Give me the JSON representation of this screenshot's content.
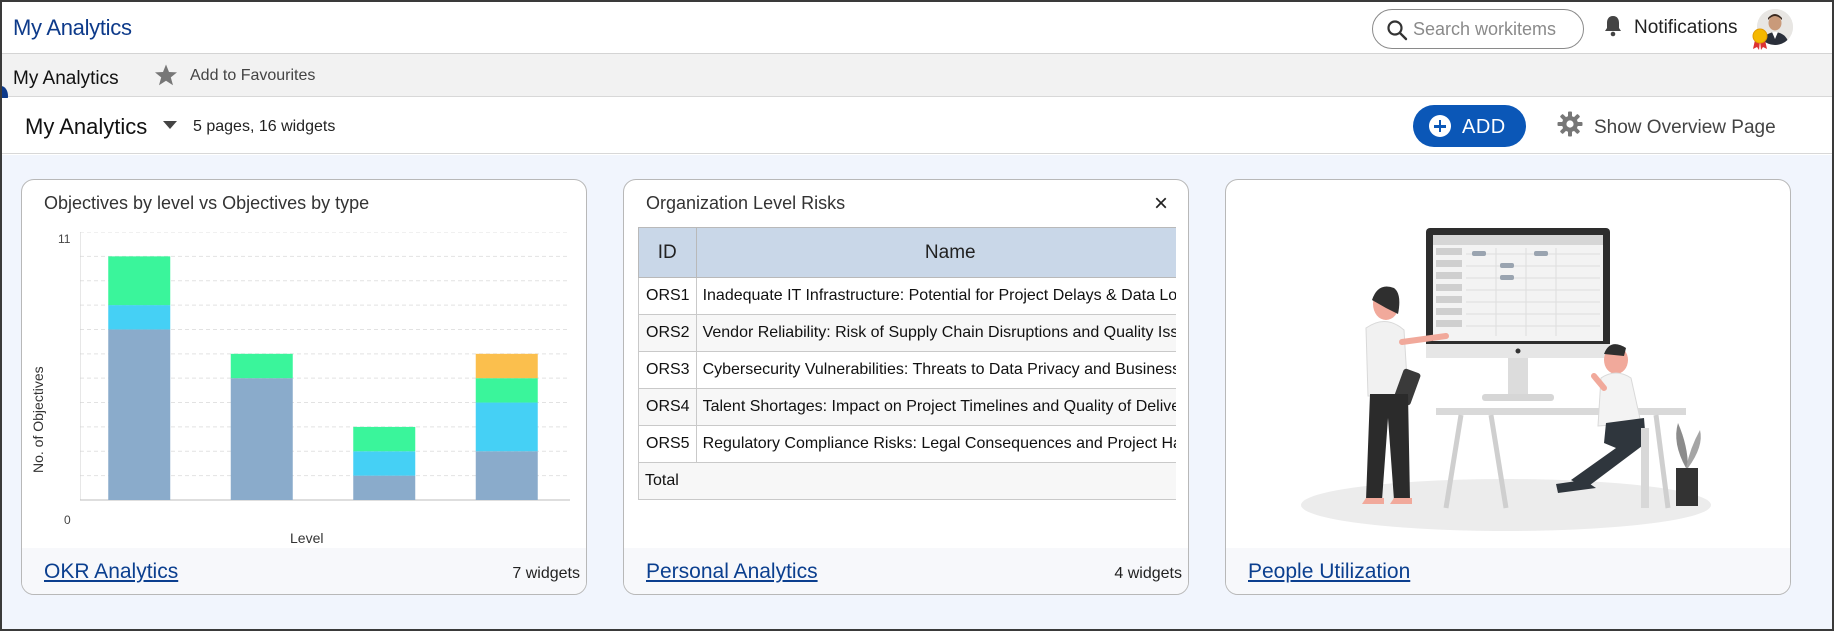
{
  "app": {
    "title": "My Analytics"
  },
  "search": {
    "placeholder": "Search workitems"
  },
  "notifications": {
    "label": "Notifications"
  },
  "breadcrumb": {
    "title": "My Analytics",
    "favourite_label": "Add to Favourites"
  },
  "dashboard": {
    "title": "My Analytics",
    "meta": "5 pages, 16 widgets",
    "add_label": "ADD",
    "overview_label": "Show Overview Page"
  },
  "colors": {
    "accent": "#0b57b7",
    "link": "#0b3f8f",
    "bar_blue": "#8aabcb",
    "bar_cyan": "#45d0f5",
    "bar_green": "#3af59b",
    "bar_orange": "#fbbf4d"
  },
  "cards": [
    {
      "link": "OKR Analytics",
      "count": "7 widgets",
      "widget_title": "Objectives by level vs Objectives by type",
      "chart": {
        "ylabel": "No. of Objectives",
        "xlabel": "Level",
        "ymin_label": "0",
        "ymax_label": "11"
      }
    },
    {
      "link": "Personal Analytics",
      "count": "4 widgets",
      "widget_title": "Organization Level Risks",
      "close_icon": "×",
      "table": {
        "headers": [
          "ID",
          "Name"
        ],
        "rows": [
          [
            "ORS1",
            "Inadequate IT Infrastructure: Potential for Project Delays & Data Los"
          ],
          [
            "ORS2",
            "Vendor Reliability: Risk of Supply Chain Disruptions and Quality Issu"
          ],
          [
            "ORS3",
            "Cybersecurity Vulnerabilities: Threats to Data Privacy and Business C"
          ],
          [
            "ORS4",
            "Talent Shortages: Impact on Project Timelines and Quality of Deliver"
          ],
          [
            "ORS5",
            "Regulatory Compliance Risks: Legal Consequences and Project Halts"
          ]
        ],
        "total_label": "Total"
      }
    },
    {
      "link": "People Utilization",
      "count": "",
      "illustration": "people-at-computer-illustration"
    }
  ],
  "chart_data": {
    "type": "bar",
    "title": "Objectives by level vs Objectives by type",
    "xlabel": "Level",
    "ylabel": "No. of Objectives",
    "ylim": [
      0,
      11
    ],
    "grid": true,
    "stacked": true,
    "categories": [
      "",
      "",
      "",
      ""
    ],
    "series": [
      {
        "color": "#8aabcb",
        "values": [
          7,
          5,
          1,
          2
        ]
      },
      {
        "color": "#45d0f5",
        "values": [
          1,
          0,
          1,
          2
        ]
      },
      {
        "color": "#3af59b",
        "values": [
          2,
          1,
          1,
          1
        ]
      },
      {
        "color": "#fbbf4d",
        "values": [
          0,
          0,
          0,
          1
        ]
      }
    ]
  }
}
